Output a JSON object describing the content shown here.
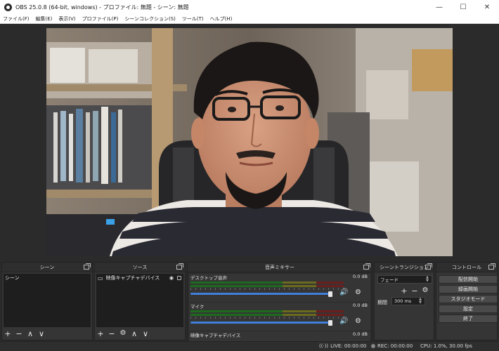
{
  "window": {
    "title": "OBS 25.0.8 (64-bit, windows) - プロファイル: 無題 - シーン: 無題",
    "minimize": "—",
    "maximize": "☐",
    "close": "✕"
  },
  "menu": {
    "items": [
      {
        "label": "ファイル(F)"
      },
      {
        "label": "編集(E)"
      },
      {
        "label": "表示(V)"
      },
      {
        "label": "プロファイル(P)"
      },
      {
        "label": "シーンコレクション(S)"
      },
      {
        "label": "ツール(T)"
      },
      {
        "label": "ヘルプ(H)"
      }
    ]
  },
  "docks": {
    "scenes": {
      "title": "シーン",
      "items": [
        "シーン"
      ]
    },
    "sources": {
      "title": "ソース",
      "items": [
        "映像キャプチャデバイス"
      ]
    },
    "mixer": {
      "title": "音声ミキサー",
      "channels": [
        {
          "name": "デスクトップ音声",
          "db": "0.0 dB",
          "level": 1.0
        },
        {
          "name": "マイク",
          "db": "0.0 dB",
          "level": 1.0
        },
        {
          "name": "映像キャプチャデバイス",
          "db": "0.0 dB",
          "level": 1.0
        }
      ]
    },
    "transitions": {
      "title": "シーントランジション",
      "selected": "フェード",
      "duration_label": "期間",
      "duration_value": "300 ms"
    },
    "controls": {
      "title": "コントロール",
      "buttons": [
        "配信開始",
        "録画開始",
        "スタジオモード",
        "設定",
        "終了"
      ]
    }
  },
  "status": {
    "live": "LIVE: 00:00:00",
    "rec": "REC: 00:00:00",
    "cpu": "CPU: 1.0%, 30.00 fps"
  },
  "icons": {
    "plus": "+",
    "minus": "−",
    "up": "∧",
    "down": "∨",
    "gear": "⚙",
    "eye": "◉",
    "lock": "🔒",
    "volume": "🔊",
    "camera": "▭"
  }
}
